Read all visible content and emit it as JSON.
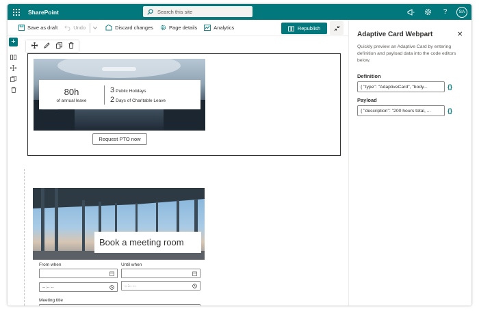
{
  "suitebar": {
    "brand": "SharePoint",
    "search_placeholder": "Search this site",
    "avatar_initials": "SA"
  },
  "commandbar": {
    "save_draft": "Save as draft",
    "undo": "Undo",
    "discard": "Discard changes",
    "page_details": "Page details",
    "analytics": "Analytics",
    "republish": "Republish"
  },
  "pto_card": {
    "hours": "80h",
    "hours_label": "of annual leave",
    "items": [
      {
        "count": "3",
        "label": "Public Holidays"
      },
      {
        "count": "2",
        "label": "Days of Charitable Leave"
      }
    ],
    "button": "Request PTO now"
  },
  "meeting_card": {
    "title": "Book a meeting room",
    "from_label": "From when",
    "until_label": "Until when",
    "time_placeholder": "--:-- --",
    "meeting_title_label": "Meeting title"
  },
  "panel": {
    "title": "Adaptive Card Webpart",
    "description": "Quickly preview an Adaptive Card by entering definition and payload data into the code editors below.",
    "definition_label": "Definition",
    "definition_value": "{    \"type\": \"AdaptiveCard\",    \"body...",
    "payload_label": "Payload",
    "payload_value": "{    \"description\": \"200 hours total, ...",
    "brace_icon": "{}"
  },
  "colors": {
    "brand": "#03787c",
    "text": "#323130",
    "subtle": "#605e5c"
  }
}
